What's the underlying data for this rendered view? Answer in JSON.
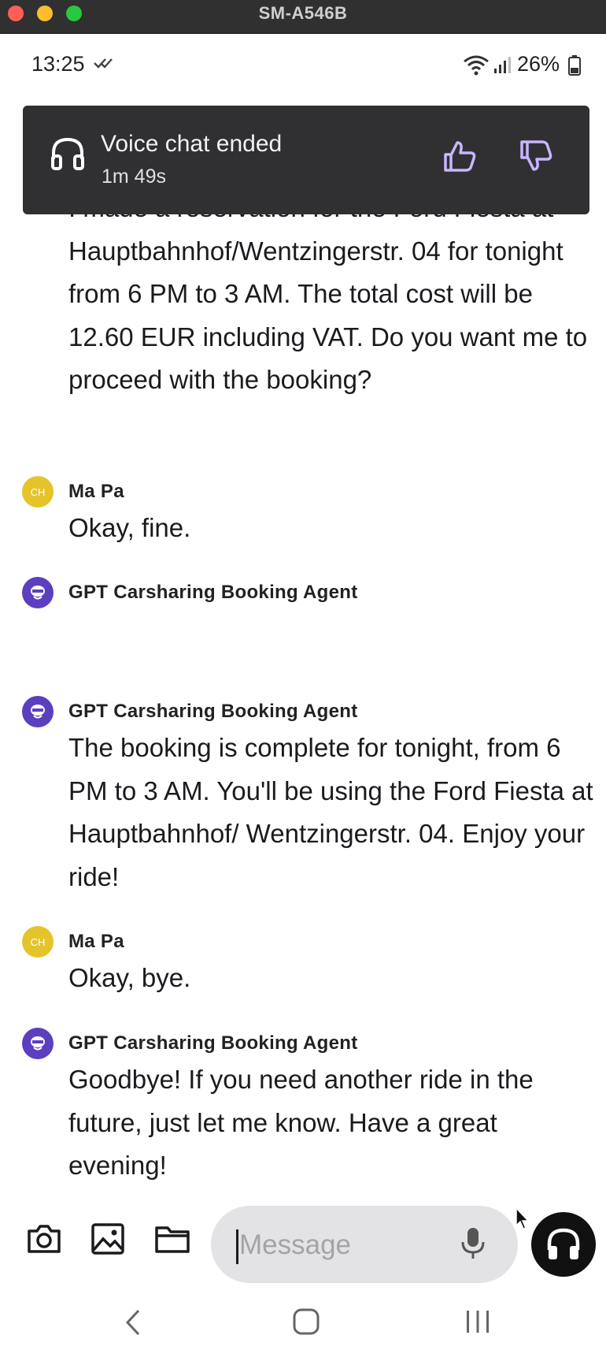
{
  "window": {
    "title": "SM-A546B"
  },
  "status_bar": {
    "time": "13:25",
    "battery": "26%"
  },
  "snackbar": {
    "title": "Voice chat ended",
    "duration": "1m 49s"
  },
  "messages": [
    {
      "text": "I made a reservation for the Ford Fiesta at Hauptbahnhof/Wentzingerstr. 04 for tonight from 6 PM to 3 AM. The total cost will be 12.60 EUR including VAT. Do you want me to proceed with the booking?"
    },
    {
      "sender": "Ma Pa",
      "avatar": "CH",
      "text": "Okay, fine."
    },
    {
      "sender": "GPT Carsharing Booking Agent",
      "text": ""
    },
    {
      "sender": "GPT Carsharing Booking Agent",
      "text": "The booking is complete for tonight, from 6 PM to 3 AM. You'll be using the Ford Fiesta at Hauptbahnhof/ Wentzingerstr. 04. Enjoy your ride!"
    },
    {
      "sender": "Ma Pa",
      "avatar": "CH",
      "text": "Okay, bye."
    },
    {
      "sender": "GPT Carsharing Booking Agent",
      "text": "Goodbye! If you need another ride in the future, just let me know. Have a great evening!"
    }
  ],
  "composer": {
    "placeholder": "Message"
  },
  "icons": {
    "snackbar": "headphones-icon",
    "feedback": [
      "thumbs-up-icon",
      "thumbs-down-icon"
    ],
    "tools": [
      "camera-icon",
      "image-icon",
      "folder-icon"
    ],
    "mic": "mic-icon",
    "voice": "headphones-icon"
  },
  "colors": {
    "accent": "#5b3fbf",
    "user_avatar": "#e4c42a",
    "snackbar_bg": "#303033",
    "feedback_icon": "#c9b6ff"
  }
}
